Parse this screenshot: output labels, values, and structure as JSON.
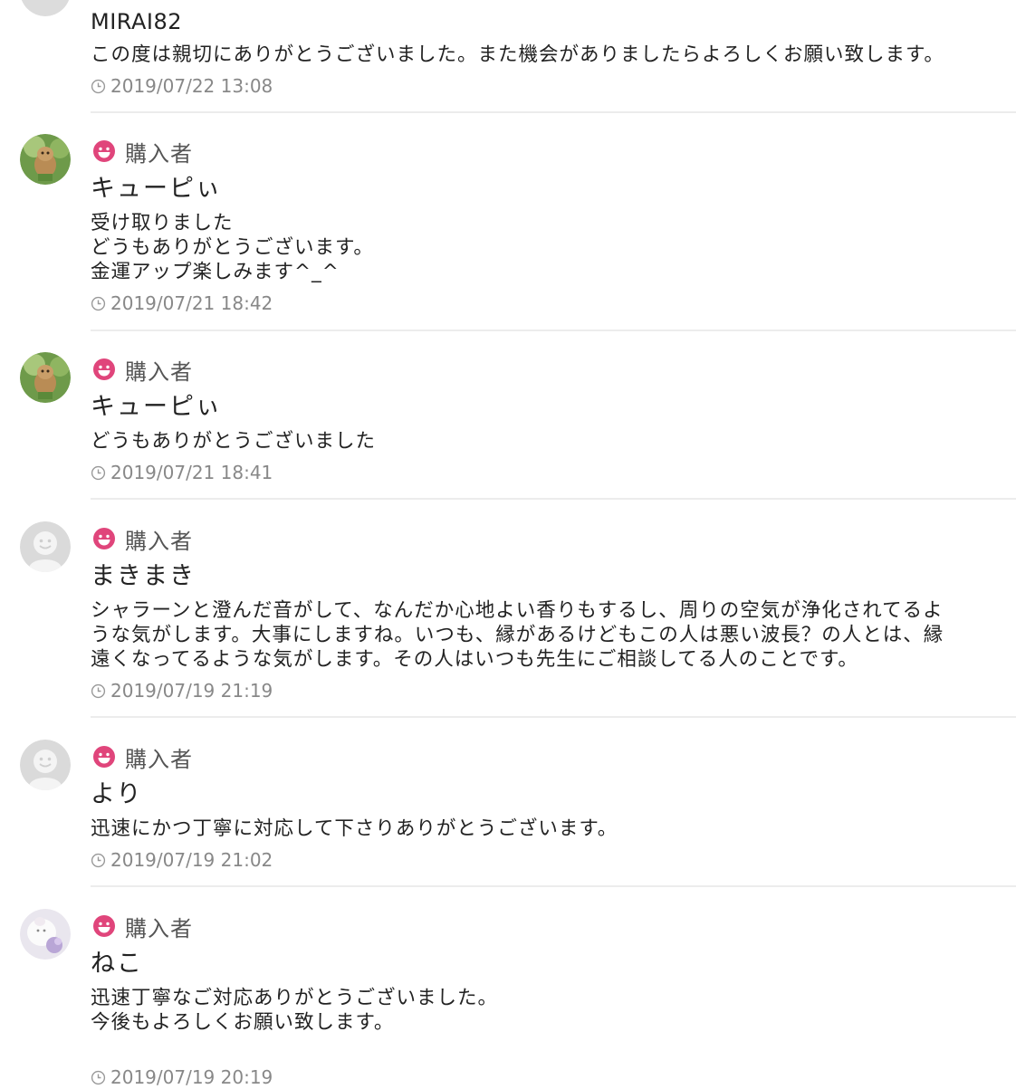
{
  "reviews": [
    {
      "username": "MIRAI82",
      "message": "この度は親切にありがとうございました。また機会がありましたらよろしくお願い致します。",
      "timestamp": "2019/07/22 13:08"
    },
    {
      "role": "購入者",
      "username": "キューピぃ",
      "message": "受け取りました\nどうもありがとうございます。\n金運アップ楽しみます^_^",
      "timestamp": "2019/07/21 18:42",
      "avatar": "dog-photo-avatar"
    },
    {
      "role": "購入者",
      "username": "キューピぃ",
      "message": "どうもありがとうございました",
      "timestamp": "2019/07/21 18:41",
      "avatar": "dog-photo-avatar"
    },
    {
      "role": "購入者",
      "username": "まきまき",
      "message": "シャラーンと澄んだ音がして、なんだか心地よい香りもするし、周りの空気が浄化されてるよ\nうな気がします。大事にしますね。いつも、縁があるけどもこの人は悪い波長？の人とは、縁\n遠くなってるような気がします。その人はいつも先生にご相談してる人のことです。",
      "timestamp": "2019/07/19 21:19",
      "avatar": "default-avatar"
    },
    {
      "role": "購入者",
      "username": "より",
      "message": "迅速にかつ丁寧に対応して下さりありがとうございます。",
      "timestamp": "2019/07/19 21:02",
      "avatar": "default-avatar"
    },
    {
      "role": "購入者",
      "username": "ねこ",
      "message": "迅速丁寧なご対応ありがとうございました。\n今後もよろしくお願い致します。",
      "timestamp": "2019/07/19 20:19",
      "avatar": "cat-photo-avatar"
    }
  ],
  "colors": {
    "role_icon": "#e0457b",
    "timestamp": "#888888",
    "divider": "#ececec"
  },
  "icons": {
    "role": "smiley-face-icon",
    "time": "clock-icon"
  }
}
